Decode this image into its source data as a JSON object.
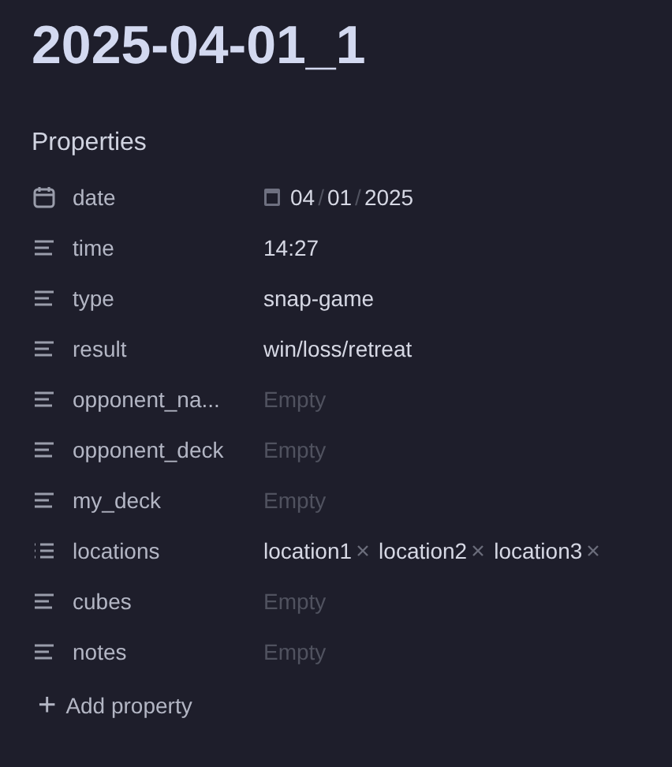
{
  "title": "2025-04-01_1",
  "properties_heading": "Properties",
  "properties": [
    {
      "name": "date",
      "kind": "date",
      "date_parts": [
        {
          "kind": "digits",
          "text": "04"
        },
        {
          "kind": "separator",
          "text": "/"
        },
        {
          "kind": "digits",
          "text": "01"
        },
        {
          "kind": "separator",
          "text": "/"
        },
        {
          "kind": "digits",
          "text": "2025"
        }
      ]
    },
    {
      "name": "time",
      "kind": "text",
      "value": "14:27"
    },
    {
      "name": "type",
      "kind": "text",
      "value": "snap-game"
    },
    {
      "name": "result",
      "kind": "text",
      "value": "win/loss/retreat"
    },
    {
      "name": "opponent_na...",
      "kind": "text",
      "placeholder": "Empty"
    },
    {
      "name": "opponent_deck",
      "kind": "text",
      "placeholder": "Empty"
    },
    {
      "name": "my_deck",
      "kind": "text",
      "placeholder": "Empty"
    },
    {
      "name": "locations",
      "kind": "list",
      "tags": [
        "location1",
        "location2",
        "location3"
      ]
    },
    {
      "name": "cubes",
      "kind": "text",
      "placeholder": "Empty"
    },
    {
      "name": "notes",
      "kind": "text",
      "placeholder": "Empty"
    }
  ],
  "add_property": {
    "icon": "+",
    "label": "Add property"
  }
}
